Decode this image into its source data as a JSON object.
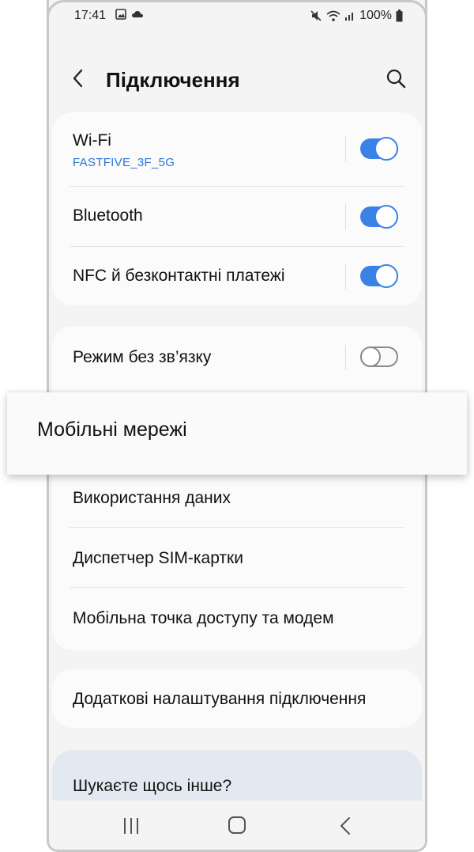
{
  "status_bar": {
    "time": "17:41",
    "battery": "100%",
    "icons": [
      "image-icon",
      "cloud-icon",
      "mute-icon",
      "wifi-icon",
      "signal-icon",
      "battery-icon"
    ]
  },
  "header": {
    "title": "Підключення",
    "back_icon": "chevron-left-icon",
    "search_icon": "search-icon"
  },
  "group1": {
    "wifi": {
      "label": "Wi-Fi",
      "network": "FASTFIVE_3F_5G",
      "enabled": true
    },
    "bluetooth": {
      "label": "Bluetooth",
      "enabled": true
    },
    "nfc": {
      "label": "NFC й безконтактні платежі",
      "enabled": true
    }
  },
  "group2": {
    "airplane": {
      "label": "Режим без зв’язку",
      "enabled": false
    },
    "mobile_networks": {
      "label": "Мобільні мережі"
    },
    "data_usage": {
      "label": "Використання даних"
    },
    "sim_manager": {
      "label": "Диспетчер SIM-картки"
    },
    "hotspot": {
      "label": "Мобільна точка доступу та модем"
    }
  },
  "group3": {
    "more_settings": {
      "label": "Додаткові налаштування підключення"
    }
  },
  "suggestion": {
    "label": "Шукаєте щось інше?"
  },
  "nav_bar": {
    "icons": [
      "recents-icon",
      "home-icon",
      "back-icon"
    ]
  },
  "colors": {
    "accent": "#3a82e6",
    "network_text": "#2a75d6",
    "background": "#f4f4f4",
    "card": "#fbfbfb",
    "suggestion_card": "#e3e9f0"
  }
}
